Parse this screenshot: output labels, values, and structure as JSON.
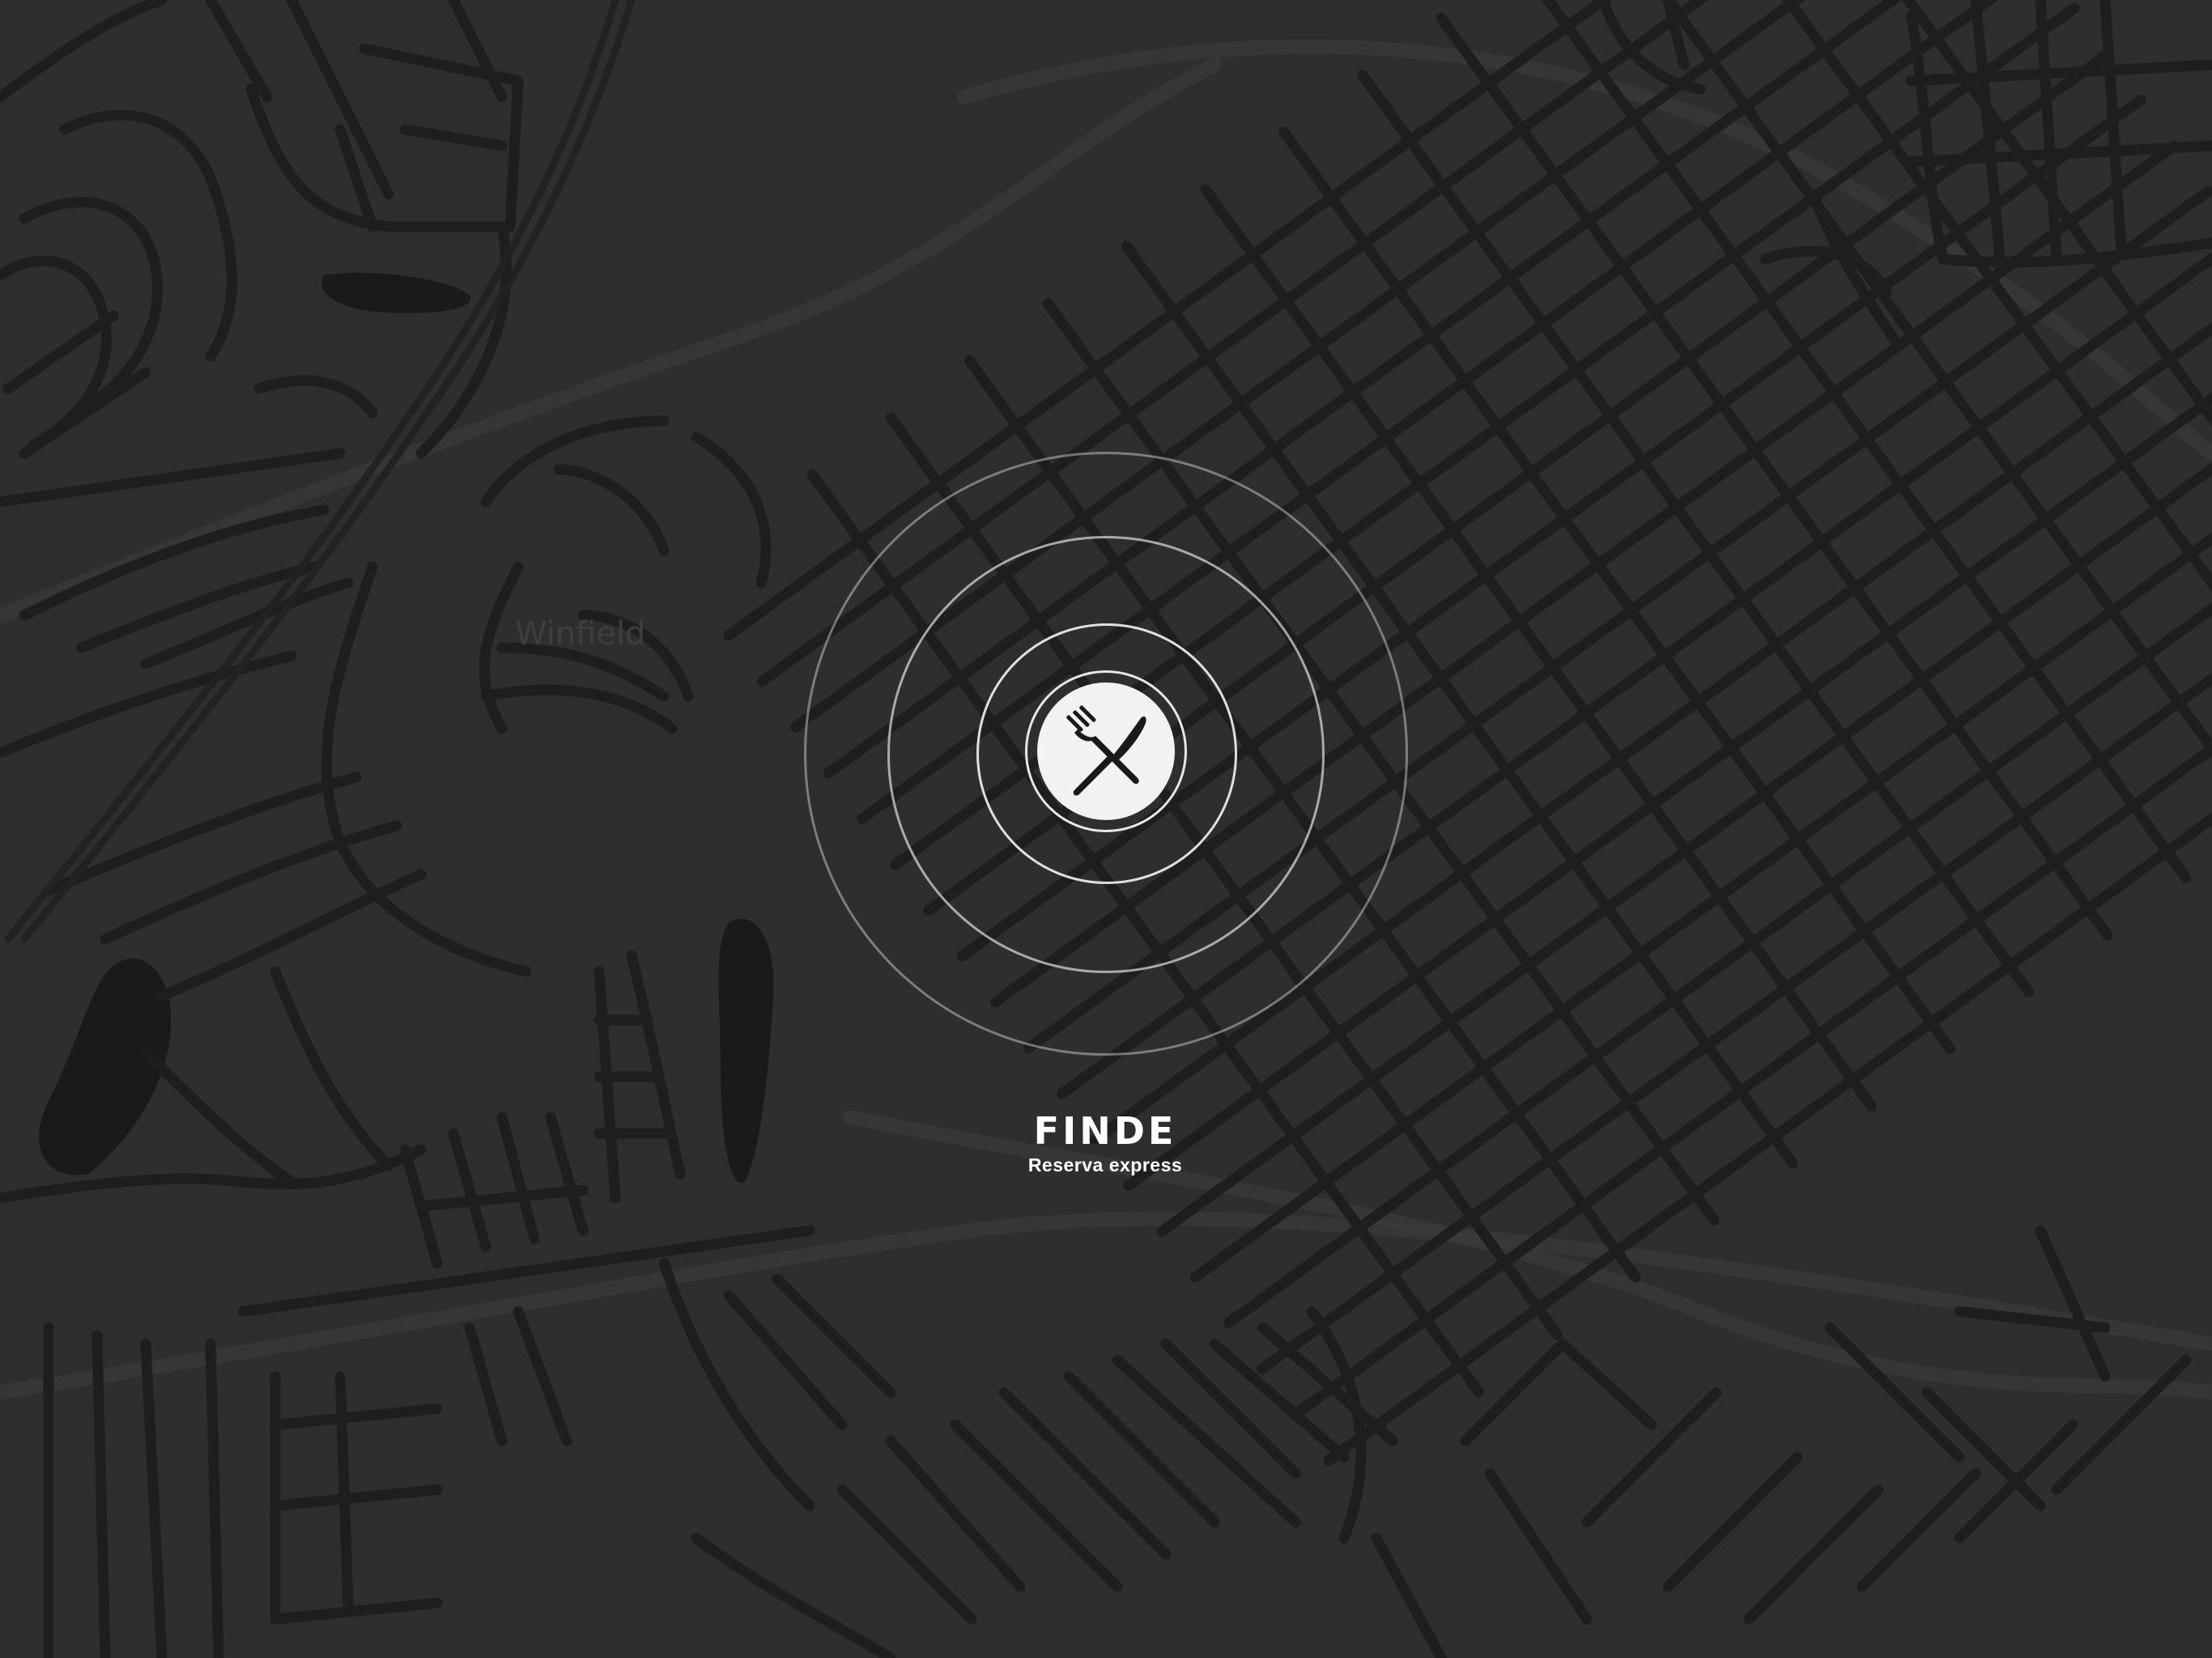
{
  "map": {
    "place_label": "Winfield"
  },
  "brand": {
    "name": "FINDE",
    "tagline": "Reserva express",
    "logo_icon": "fork-knife-icon"
  },
  "colors": {
    "background": "#2e2e2e",
    "roads": "#1e1e1e",
    "rings": "#e8e8e8",
    "text": "#ffffff"
  }
}
